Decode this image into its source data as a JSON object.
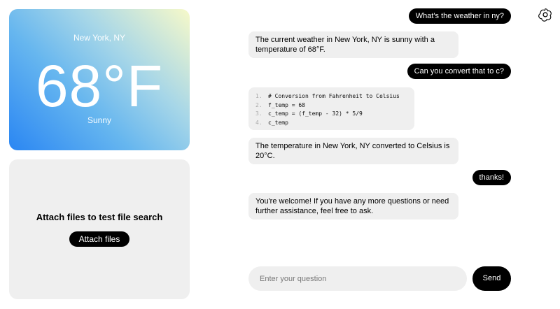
{
  "weather": {
    "location": "New York, NY",
    "temperature": "68°F",
    "condition": "Sunny"
  },
  "files": {
    "title": "Attach files to test file search",
    "button_label": "Attach files"
  },
  "messages": [
    {
      "role": "user",
      "text": "What's the weather in ny?"
    },
    {
      "role": "assistant",
      "text": "The current weather in New York, NY is sunny with a temperature of 68°F."
    },
    {
      "role": "user",
      "text": "Can you convert that to c?"
    },
    {
      "role": "code",
      "lines": [
        {
          "num": "1.",
          "text": "# Conversion from Fahrenheit to Celsius"
        },
        {
          "num": "2.",
          "text": "f_temp = 68"
        },
        {
          "num": "3.",
          "text": "c_temp = (f_temp - 32) * 5/9"
        },
        {
          "num": "4.",
          "text": "c_temp"
        }
      ]
    },
    {
      "role": "assistant",
      "text": "The temperature in New York, NY converted to Celsius is 20°C."
    },
    {
      "role": "user",
      "text": "thanks!"
    },
    {
      "role": "assistant",
      "text": "You're welcome! If you have any more questions or need further assistance, feel free to ask."
    }
  ],
  "composer": {
    "placeholder": "Enter your question",
    "send_label": "Send"
  },
  "logo_icon": "openai-logo-icon"
}
